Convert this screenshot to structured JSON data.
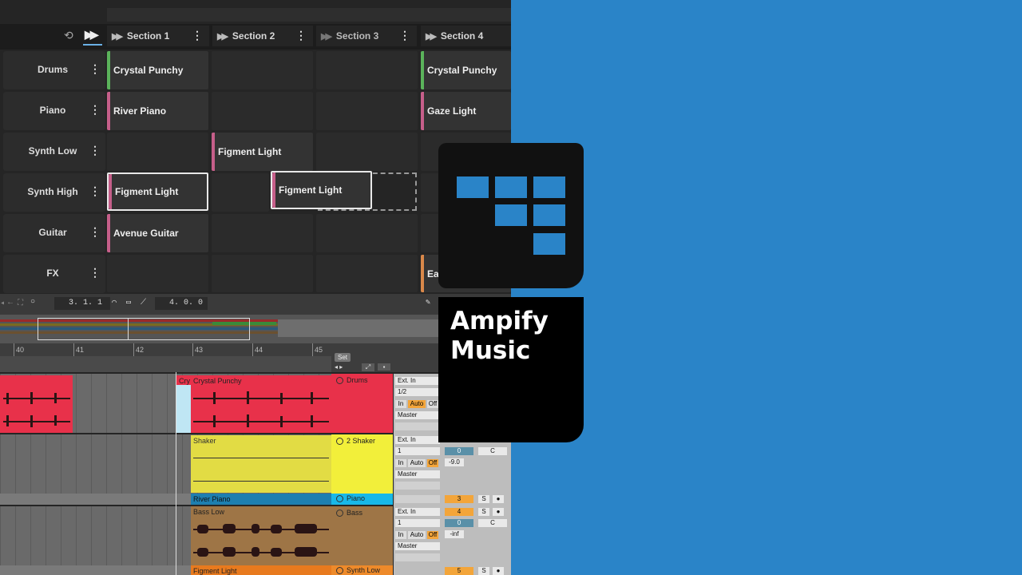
{
  "sections": [
    {
      "label": "Section 1"
    },
    {
      "label": "Section 2"
    },
    {
      "label": "Section 3"
    },
    {
      "label": "Section 4"
    }
  ],
  "tracks": [
    {
      "label": "Drums"
    },
    {
      "label": "Piano"
    },
    {
      "label": "Synth Low"
    },
    {
      "label": "Synth High"
    },
    {
      "label": "Guitar"
    },
    {
      "label": "FX"
    }
  ],
  "clips": [
    {
      "text": "Crystal Punchy",
      "color": "#5bb35b"
    },
    {
      "text": "Crystal Punchy",
      "color": "#5bb35b"
    },
    {
      "text": "River Piano",
      "color": "#c65f8a"
    },
    {
      "text": "Gaze Light",
      "color": "#c65f8a"
    },
    {
      "text": "Figment Light",
      "color": "#c65f8a"
    },
    {
      "text": "Figment Light",
      "color": "#c65f8a"
    },
    {
      "text": "Figment Light",
      "color": "#c65f8a"
    },
    {
      "text": "Avenue Guitar",
      "color": "#c65f8a"
    },
    {
      "text": "Ea",
      "color": "#d9884a"
    }
  ],
  "transport": {
    "position": "3. 1. 1",
    "length": "4. 0. 0"
  },
  "ruler": [
    "40",
    "41",
    "42",
    "43",
    "44",
    "45"
  ],
  "set_label": "Set",
  "arrangement": {
    "clips": [
      {
        "name": "Cry",
        "color": "#e8314a"
      },
      {
        "name": "Crystal Punchy",
        "color": "#e8314a"
      },
      {
        "name": "Shaker",
        "color": "#e2dc44"
      },
      {
        "name": "River Piano",
        "color": "#1d7fb0"
      },
      {
        "name": "Bass Low",
        "color": "#9e7546"
      },
      {
        "name": "Figment Light",
        "color": "#e87a1e"
      }
    ],
    "tracks": [
      {
        "name": "Drums",
        "color": "#e8314a"
      },
      {
        "name": "2 Shaker",
        "color": "#f2ef3a"
      },
      {
        "name": "Piano",
        "color": "#18b8e8"
      },
      {
        "name": "Bass",
        "color": "#9e7546"
      },
      {
        "name": "Synth Low",
        "color": "#ee8a2a"
      }
    ],
    "io": {
      "ext_in": "Ext. In",
      "half": "1/2",
      "one": "1",
      "master": "Master",
      "in": "In",
      "auto": "Auto",
      "off": "Off"
    },
    "mixer": {
      "vol_zero": "0",
      "pan": "C",
      "vol_shaker": "-9.0",
      "vol_bass": "-inf",
      "num3": "3",
      "num4": "4",
      "num5": "5",
      "solo": "S"
    }
  },
  "brand": {
    "name": "Ampify Music",
    "accent": "#2a84c8"
  }
}
